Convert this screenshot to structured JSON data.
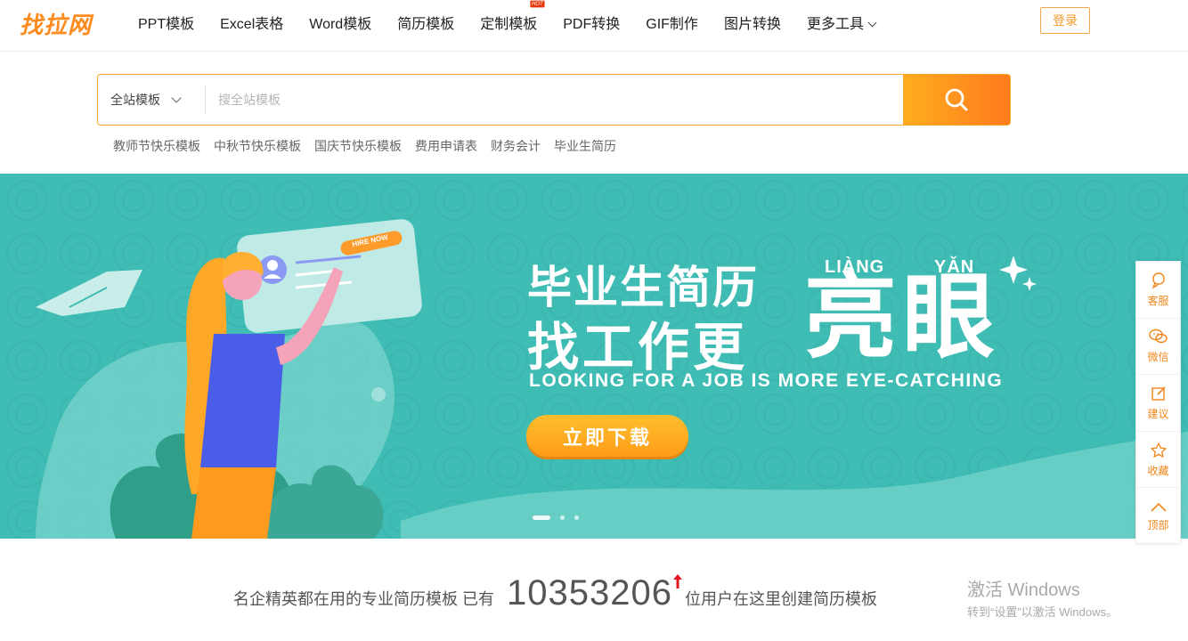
{
  "header": {
    "logo_text": "找拉网",
    "nav": [
      {
        "label": "PPT模板"
      },
      {
        "label": "Excel表格"
      },
      {
        "label": "Word模板"
      },
      {
        "label": "简历模板"
      },
      {
        "label": "定制模板",
        "badge": "HOT"
      },
      {
        "label": "PDF转换"
      },
      {
        "label": "GIF制作"
      },
      {
        "label": "图片转换"
      },
      {
        "label": "更多工具"
      }
    ],
    "login_label": "登录"
  },
  "search": {
    "scope_label": "全站模板",
    "placeholder": "搜全站模板",
    "hot_tags": [
      "教师节快乐模板",
      "中秋节快乐模板",
      "国庆节快乐模板",
      "费用申请表",
      "财务会计",
      "毕业生简历"
    ]
  },
  "banner": {
    "headline_line1": "毕业生简历",
    "headline_line2": "找工作更",
    "headline_big": "亮眼",
    "pinyin_1": "LIÀNG",
    "pinyin_2": "YǍN",
    "subtitle": "LOOKING FOR A JOB IS MORE EYE-CATCHING",
    "card_tag": "HIRE NOW",
    "cta_label": "立即下载",
    "slide_count": 3,
    "active_slide": 1,
    "colors": {
      "background": "#3fbcb4",
      "cta": "#ffa51e"
    }
  },
  "sidebar": {
    "items": [
      {
        "label": "客服",
        "icon": "customer-service-icon"
      },
      {
        "label": "微信",
        "icon": "wechat-icon"
      },
      {
        "label": "建议",
        "icon": "edit-icon"
      },
      {
        "label": "收藏",
        "icon": "star-icon"
      },
      {
        "label": "顶部",
        "icon": "chevron-up-icon"
      }
    ],
    "accent_color": "#f08519"
  },
  "stats": {
    "prefix": "名企精英都在用的专业简历模板 已有",
    "count": "10353206",
    "suffix": "位用户在这里创建简历模板"
  },
  "os_watermark": {
    "line1": "激活 Windows",
    "line2": "转到“设置”以激活 Windows。"
  }
}
